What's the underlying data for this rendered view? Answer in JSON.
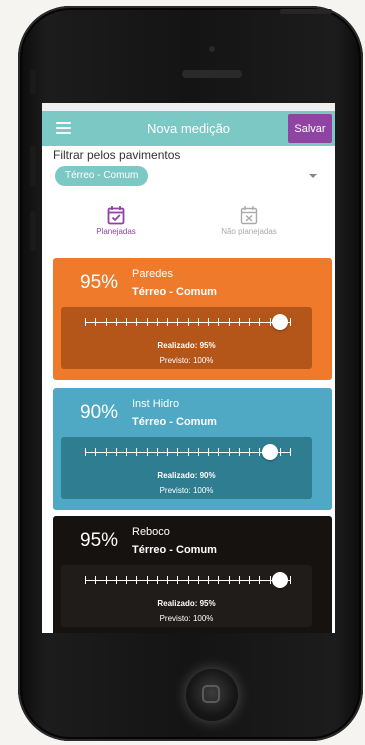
{
  "appbar": {
    "title": "Nova medição",
    "save_label": "Salvar"
  },
  "filter": {
    "label": "Filtrar pelos pavimentos",
    "chip": "Térreo - Comum"
  },
  "tabs": [
    {
      "label": "Planejadas",
      "icon": "calendar-check-icon",
      "active": true
    },
    {
      "label": "Não planejadas",
      "icon": "calendar-x-icon",
      "active": false
    }
  ],
  "cards": [
    {
      "percent": "95%",
      "name": "Paredes",
      "floor": "Térreo - Comum",
      "realizado": "Realizado: 95%",
      "previsto": "Previsto: 100%",
      "progress": 95,
      "color": "#ef7a2b",
      "inner_color": "#b4551a"
    },
    {
      "percent": "90%",
      "name": "Inst Hidro",
      "floor": "Térreo - Comum",
      "realizado": "Realizado: 90%",
      "previsto": "Previsto: 100%",
      "progress": 90,
      "color": "#4fa9c4",
      "inner_color": "#2f7d90"
    },
    {
      "percent": "95%",
      "name": "Reboco",
      "floor": "Térreo - Comum",
      "realizado": "Realizado: 95%",
      "previsto": "Previsto: 100%",
      "progress": 95,
      "color": "#161210",
      "inner_color": "#201c19"
    }
  ],
  "colors": {
    "primary": "#7cc8c4",
    "accent": "#8f44a3"
  }
}
